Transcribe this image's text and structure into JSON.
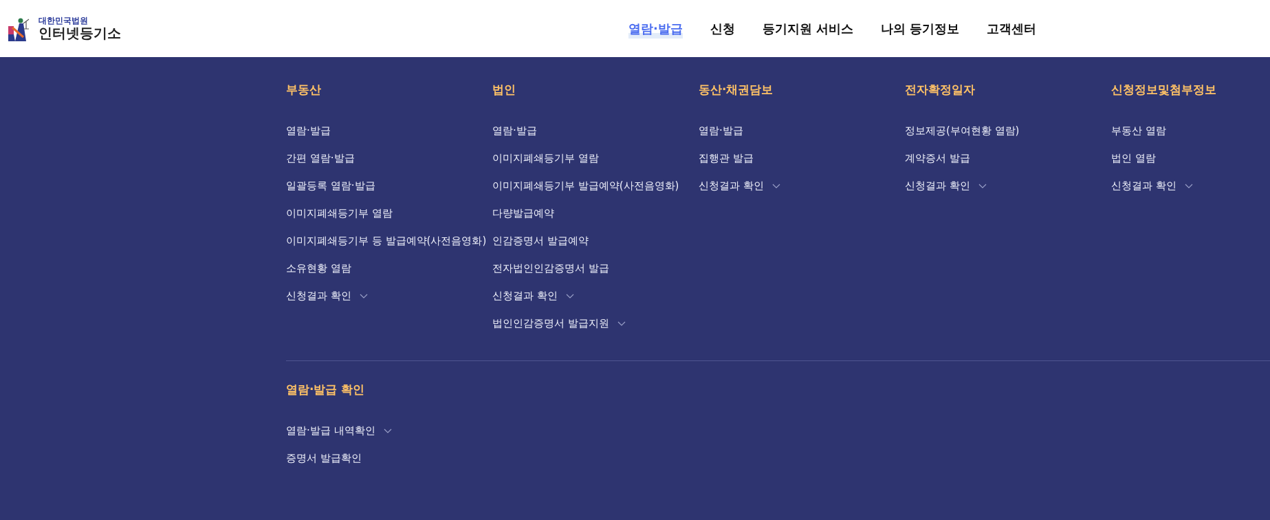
{
  "logo": {
    "subtitle": "대한민국법원",
    "title": "인터넷등기소"
  },
  "nav": [
    {
      "label": "열람·발급",
      "selected": true
    },
    {
      "label": "신청",
      "selected": false
    },
    {
      "label": "등기지원 서비스",
      "selected": false
    },
    {
      "label": "나의 등기정보",
      "selected": false
    },
    {
      "label": "고객센터",
      "selected": false
    }
  ],
  "menu_sections": [
    {
      "columns": [
        {
          "heading": "부동산",
          "items": [
            {
              "label": "열람·발급",
              "kind": "link"
            },
            {
              "label": "간편 열람·발급",
              "kind": "link"
            },
            {
              "label": "일괄등록 열람·발급",
              "kind": "link"
            },
            {
              "label": "이미지폐쇄등기부 열람",
              "kind": "link"
            },
            {
              "label": "이미지폐쇄등기부 등 발급예약(사전음영화)",
              "kind": "link"
            },
            {
              "label": "소유현황 열람",
              "kind": "link"
            },
            {
              "label": "신청결과 확인",
              "kind": "dropdown"
            }
          ]
        },
        {
          "heading": "법인",
          "items": [
            {
              "label": "열람·발급",
              "kind": "link"
            },
            {
              "label": "이미지폐쇄등기부 열람",
              "kind": "link"
            },
            {
              "label": "이미지폐쇄등기부 발급예약(사전음영화)",
              "kind": "link"
            },
            {
              "label": "다량발급예약",
              "kind": "link"
            },
            {
              "label": "인감증명서 발급예약",
              "kind": "link"
            },
            {
              "label": "전자법인인감증명서 발급",
              "kind": "link"
            },
            {
              "label": "신청결과 확인",
              "kind": "dropdown"
            },
            {
              "label": "법인인감증명서 발급지원",
              "kind": "dropdown"
            }
          ]
        },
        {
          "heading": "동산·채권담보",
          "items": [
            {
              "label": "열람·발급",
              "kind": "link"
            },
            {
              "label": "집행관 발급",
              "kind": "link"
            },
            {
              "label": "신청결과 확인",
              "kind": "dropdown"
            }
          ]
        },
        {
          "heading": "전자확정일자",
          "items": [
            {
              "label": "정보제공(부여현황 열람)",
              "kind": "link"
            },
            {
              "label": "계약증서 발급",
              "kind": "link"
            },
            {
              "label": "신청결과 확인",
              "kind": "dropdown"
            }
          ]
        },
        {
          "heading": "신청정보및첨부정보",
          "items": [
            {
              "label": "부동산 열람",
              "kind": "link"
            },
            {
              "label": "법인 열람",
              "kind": "link"
            },
            {
              "label": "신청결과 확인",
              "kind": "dropdown"
            }
          ]
        }
      ]
    },
    {
      "columns": [
        {
          "heading": "열람·발급 확인",
          "items": [
            {
              "label": "열람·발급 내역확인",
              "kind": "dropdown"
            },
            {
              "label": "증명서 발급확인",
              "kind": "link"
            }
          ]
        }
      ]
    }
  ]
}
